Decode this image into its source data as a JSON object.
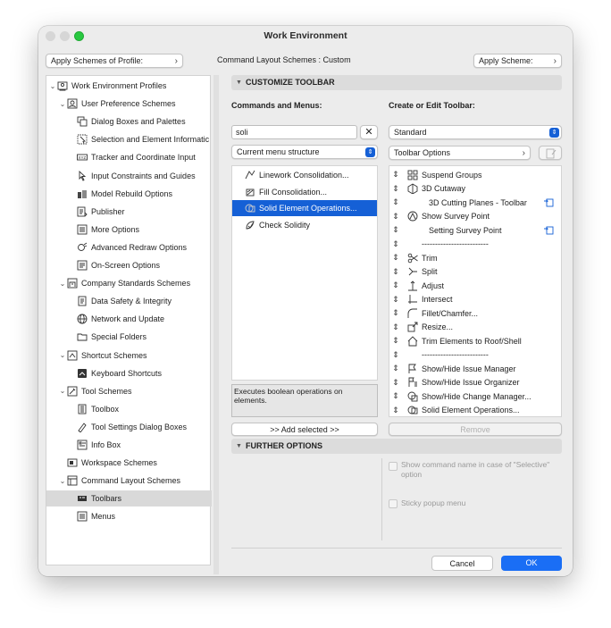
{
  "window": {
    "title": "Work Environment"
  },
  "top": {
    "apply_profile_label": "Apply Schemes of Profile:",
    "scheme_caption": "Command Layout Schemes : Custom",
    "apply_scheme_label": "Apply Scheme:"
  },
  "tree": {
    "items": [
      {
        "label": "Work Environment Profiles",
        "level": 0,
        "arrow": "v",
        "icon": "profiles-icon"
      },
      {
        "label": "User Preference Schemes",
        "level": 1,
        "arrow": "v",
        "icon": "user-prefs-icon"
      },
      {
        "label": "Dialog Boxes and Palettes",
        "level": 2,
        "arrow": "",
        "icon": "dialog-boxes-icon"
      },
      {
        "label": "Selection and Element Informatic",
        "level": 2,
        "arrow": "",
        "icon": "selection-icon"
      },
      {
        "label": "Tracker and Coordinate Input",
        "level": 2,
        "arrow": "",
        "icon": "xyz-icon"
      },
      {
        "label": "Input Constraints and Guides",
        "level": 2,
        "arrow": "",
        "icon": "cursor-icon"
      },
      {
        "label": "Model Rebuild Options",
        "level": 2,
        "arrow": "",
        "icon": "rebuild-icon"
      },
      {
        "label": "Publisher",
        "level": 2,
        "arrow": "",
        "icon": "publisher-icon"
      },
      {
        "label": "More Options",
        "level": 2,
        "arrow": "",
        "icon": "more-options-icon"
      },
      {
        "label": "Advanced Redraw Options",
        "level": 2,
        "arrow": "",
        "icon": "redraw-icon"
      },
      {
        "label": "On-Screen Options",
        "level": 2,
        "arrow": "",
        "icon": "onscreen-icon"
      },
      {
        "label": "Company Standards Schemes",
        "level": 1,
        "arrow": "v",
        "icon": "company-icon"
      },
      {
        "label": "Data Safety & Integrity",
        "level": 2,
        "arrow": "",
        "icon": "data-safety-icon"
      },
      {
        "label": "Network and Update",
        "level": 2,
        "arrow": "",
        "icon": "globe-icon"
      },
      {
        "label": "Special Folders",
        "level": 2,
        "arrow": "",
        "icon": "folder-icon"
      },
      {
        "label": "Shortcut Schemes",
        "level": 1,
        "arrow": "v",
        "icon": "shortcut-icon"
      },
      {
        "label": "Keyboard Shortcuts",
        "level": 2,
        "arrow": "",
        "icon": "keyboard-icon"
      },
      {
        "label": "Tool Schemes",
        "level": 1,
        "arrow": "v",
        "icon": "tool-schemes-icon"
      },
      {
        "label": "Toolbox",
        "level": 2,
        "arrow": "",
        "icon": "toolbox-icon"
      },
      {
        "label": "Tool Settings Dialog Boxes",
        "level": 2,
        "arrow": "",
        "icon": "tool-settings-icon"
      },
      {
        "label": "Info Box",
        "level": 2,
        "arrow": "",
        "icon": "info-box-icon"
      },
      {
        "label": "Workspace Schemes",
        "level": 1,
        "arrow": "",
        "icon": "workspace-icon"
      },
      {
        "label": "Command Layout Schemes",
        "level": 1,
        "arrow": "v",
        "icon": "command-layout-icon"
      },
      {
        "label": "Toolbars",
        "level": 2,
        "arrow": "",
        "icon": "toolbars-icon",
        "selected": true
      },
      {
        "label": "Menus",
        "level": 2,
        "arrow": "",
        "icon": "menus-icon"
      }
    ]
  },
  "customize": {
    "header": "CUSTOMIZE TOOLBAR",
    "commands_label": "Commands and Menus:",
    "search_value": "soli",
    "menu_structure": "Current menu structure",
    "results": [
      {
        "label": "Linework Consolidation...",
        "icon": "linework-icon"
      },
      {
        "label": "Fill Consolidation...",
        "icon": "fill-consolidation-icon"
      },
      {
        "label": "Solid Element Operations...",
        "icon": "solid-ops-icon",
        "selected": true
      },
      {
        "label": "Check Solidity",
        "icon": "check-solidity-icon"
      }
    ],
    "description": "Executes boolean operations on elements.",
    "add_selected": ">> Add selected >>",
    "toolbar_label": "Create or Edit Toolbar:",
    "toolbar_select": "Standard",
    "toolbar_options": "Toolbar Options",
    "toolbar_items": [
      {
        "label": "Suspend Groups",
        "icon": "suspend-groups-icon",
        "indent": 0
      },
      {
        "label": "3D Cutaway",
        "icon": "cutaway-icon",
        "indent": 0
      },
      {
        "label": "3D Cutting Planes - Toolbar",
        "icon": "",
        "indent": 1,
        "side": true
      },
      {
        "label": "Show Survey Point",
        "icon": "survey-point-icon",
        "indent": 0
      },
      {
        "label": "Setting Survey Point",
        "icon": "",
        "indent": 1,
        "side": true
      },
      {
        "label": "-------------------------",
        "icon": "",
        "indent": 0
      },
      {
        "label": "Trim",
        "icon": "trim-icon",
        "indent": 0
      },
      {
        "label": "Split",
        "icon": "split-icon",
        "indent": 0
      },
      {
        "label": "Adjust",
        "icon": "adjust-icon",
        "indent": 0
      },
      {
        "label": "Intersect",
        "icon": "intersect-icon",
        "indent": 0
      },
      {
        "label": "Fillet/Chamfer...",
        "icon": "fillet-icon",
        "indent": 0
      },
      {
        "label": "Resize...",
        "icon": "resize-icon",
        "indent": 0
      },
      {
        "label": "Trim Elements to Roof/Shell",
        "icon": "roof-icon",
        "indent": 0
      },
      {
        "label": "-------------------------",
        "icon": "",
        "indent": 0
      },
      {
        "label": "Show/Hide Issue Manager",
        "icon": "flag-icon",
        "indent": 0
      },
      {
        "label": "Show/Hide Issue Organizer",
        "icon": "issue-organizer-icon",
        "indent": 0
      },
      {
        "label": "Show/Hide Change Manager...",
        "icon": "change-manager-icon",
        "indent": 0
      },
      {
        "label": "Solid Element Operations...",
        "icon": "solid-ops-icon",
        "indent": 0
      }
    ],
    "remove": "Remove"
  },
  "further": {
    "header": "FURTHER OPTIONS",
    "show_command_name": "Show command name in case of \"Selective\" option",
    "sticky_popup": "Sticky popup menu"
  },
  "footer": {
    "cancel": "Cancel",
    "ok": "OK"
  },
  "colors": {
    "accent": "#1560d6",
    "close": "#d4d4d4",
    "zoom": "#28c840"
  }
}
